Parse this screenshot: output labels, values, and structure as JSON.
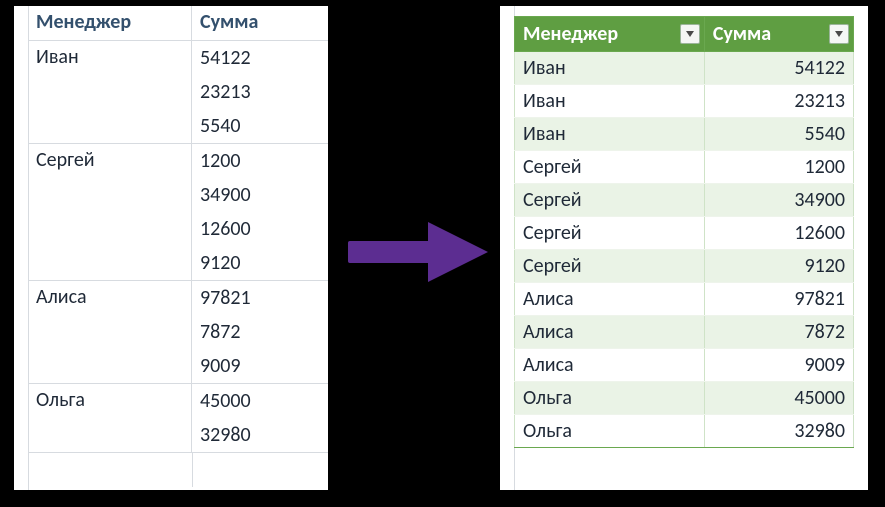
{
  "headers": {
    "manager": "Менеджер",
    "sum": "Сумма"
  },
  "left": {
    "groups": [
      {
        "manager": "Иван",
        "sums": [
          54122,
          23213,
          5540
        ]
      },
      {
        "manager": "Сергей",
        "sums": [
          1200,
          34900,
          12600,
          9120
        ]
      },
      {
        "manager": "Алиса",
        "sums": [
          97821,
          7872,
          9009
        ]
      },
      {
        "manager": "Ольга",
        "sums": [
          45000,
          32980
        ]
      }
    ]
  },
  "right": {
    "rows": [
      {
        "manager": "Иван",
        "sum": 54122
      },
      {
        "manager": "Иван",
        "sum": 23213
      },
      {
        "manager": "Иван",
        "sum": 5540
      },
      {
        "manager": "Сергей",
        "sum": 1200
      },
      {
        "manager": "Сергей",
        "sum": 34900
      },
      {
        "manager": "Сергей",
        "sum": 12600
      },
      {
        "manager": "Сергей",
        "sum": 9120
      },
      {
        "manager": "Алиса",
        "sum": 97821
      },
      {
        "manager": "Алиса",
        "sum": 7872
      },
      {
        "manager": "Алиса",
        "sum": 9009
      },
      {
        "manager": "Ольга",
        "sum": 45000
      },
      {
        "manager": "Ольга",
        "sum": 32980
      }
    ]
  },
  "colors": {
    "accent": "#5f9e42",
    "band": "#eaf3e6",
    "arrow": "#5c2d91"
  }
}
